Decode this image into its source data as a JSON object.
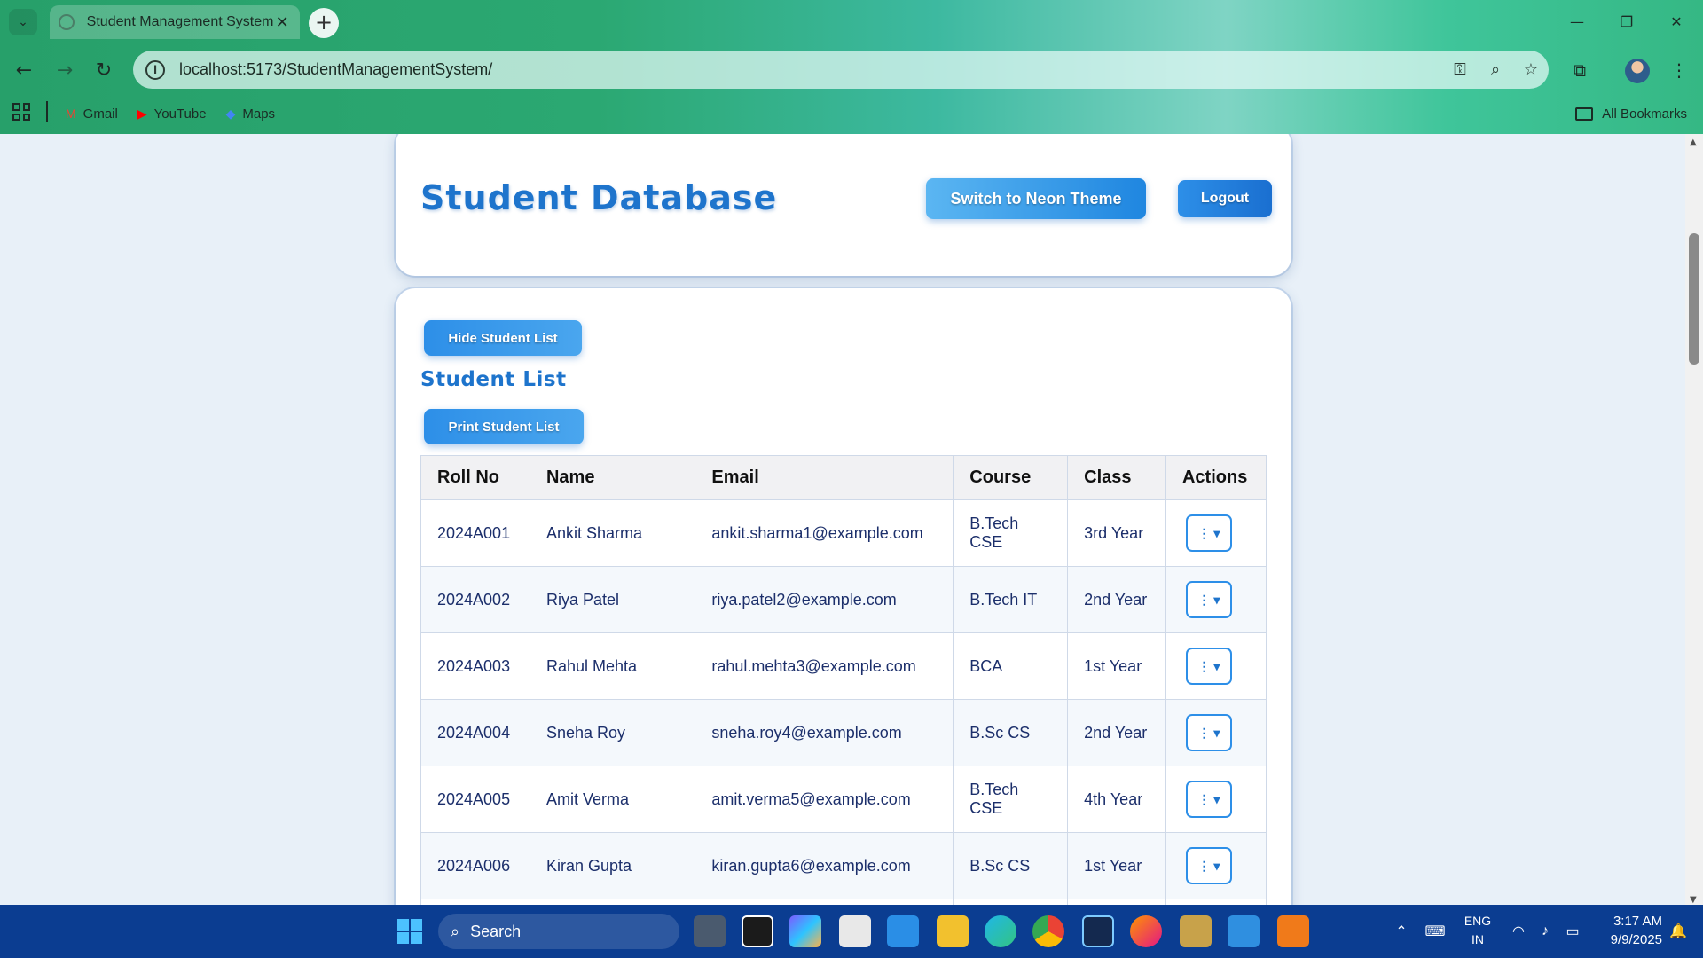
{
  "browser": {
    "tab_title": "Student Management System",
    "url": "localhost:5173/StudentManagementSystem/",
    "bookmarks": [
      {
        "label": "Gmail",
        "icon": "gmail-icon",
        "color": "#ea4335"
      },
      {
        "label": "YouTube",
        "icon": "youtube-icon",
        "color": "#ff0000"
      },
      {
        "label": "Maps",
        "icon": "maps-icon",
        "color": "#4285f4"
      }
    ],
    "all_bookmarks_label": "All Bookmarks"
  },
  "header": {
    "title": "Student Database",
    "neon_button_label": "Switch to Neon Theme",
    "logout_button_label": "Logout"
  },
  "student_list": {
    "hide_button_label": "Hide Student List",
    "title": "Student List",
    "print_button_label": "Print Student List",
    "columns": [
      "Roll No",
      "Name",
      "Email",
      "Course",
      "Class",
      "Actions"
    ],
    "rows": [
      {
        "roll": "2024A001",
        "name": "Ankit Sharma",
        "email": "ankit.sharma1@example.com",
        "course": "B.Tech CSE",
        "class": "3rd Year"
      },
      {
        "roll": "2024A002",
        "name": "Riya Patel",
        "email": "riya.patel2@example.com",
        "course": "B.Tech IT",
        "class": "2nd Year"
      },
      {
        "roll": "2024A003",
        "name": "Rahul Mehta",
        "email": "rahul.mehta3@example.com",
        "course": "BCA",
        "class": "1st Year"
      },
      {
        "roll": "2024A004",
        "name": "Sneha Roy",
        "email": "sneha.roy4@example.com",
        "course": "B.Sc CS",
        "class": "2nd Year"
      },
      {
        "roll": "2024A005",
        "name": "Amit Verma",
        "email": "amit.verma5@example.com",
        "course": "B.Tech CSE",
        "class": "4th Year"
      },
      {
        "roll": "2024A006",
        "name": "Kiran Gupta",
        "email": "kiran.gupta6@example.com",
        "course": "B.Sc CS",
        "class": "1st Year"
      }
    ],
    "action_button_glyph": "⋮ ▾"
  },
  "taskbar": {
    "search_placeholder": "Search",
    "language_line1": "ENG",
    "language_line2": "IN",
    "time": "3:17 AM",
    "date": "9/9/2025"
  },
  "colors": {
    "accent": "#1e74cc",
    "taskbar": "#0b3d91"
  }
}
